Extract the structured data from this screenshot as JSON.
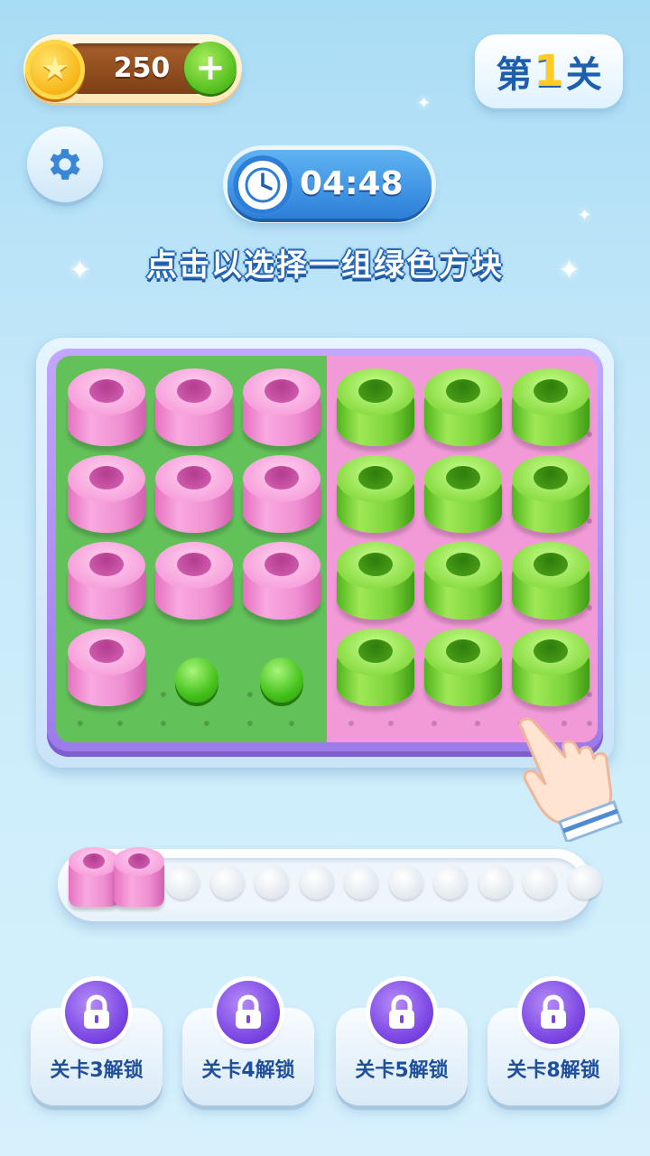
{
  "coins": {
    "value": "250",
    "add_label": "+"
  },
  "level": {
    "prefix": "第",
    "number": "1",
    "suffix": "关"
  },
  "timer": {
    "text": "04:48"
  },
  "instruction": "点击以选择一组绿色方块",
  "board": {
    "left_panel_color": "#63c15a",
    "right_panel_color": "#f29ad8",
    "left_rings": "pink",
    "right_rings": "green"
  },
  "tray": {
    "capacity": 12,
    "filled": 2,
    "filled_color": "pink"
  },
  "unlock_buttons": [
    {
      "label": "关卡3解锁"
    },
    {
      "label": "关卡4解锁"
    },
    {
      "label": "关卡5解锁"
    },
    {
      "label": "关卡8解锁"
    }
  ],
  "colors": {
    "accent_blue": "#2c7fd8",
    "title_blue": "#1d5fae",
    "lock_purple": "#7a45e3"
  }
}
